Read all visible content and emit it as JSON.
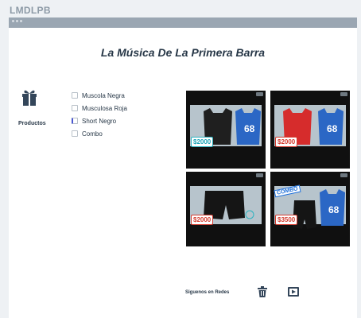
{
  "app": {
    "title": "LMDLPB"
  },
  "page": {
    "title": "La Música De La Primera Barra"
  },
  "products": {
    "label": "Productos",
    "options": [
      {
        "label": "Muscola Negra"
      },
      {
        "label": "Musculosa Roja"
      },
      {
        "label": "Short Negro"
      },
      {
        "label": "Combo"
      }
    ]
  },
  "gallery": [
    {
      "price": "$2000",
      "price_color": "#1aa4b8",
      "jersey_color": "#1f1f1f",
      "jersey2_color": "#2b67c5",
      "number": "68"
    },
    {
      "price": "$2000",
      "price_color": "#d43a2d",
      "jersey_color": "#d62c2c",
      "jersey2_color": "#2b67c5",
      "number": "68"
    },
    {
      "price": "$2000",
      "price_color": "#d43a2d",
      "jersey_color": "#151515",
      "jersey2_color": "#151515",
      "number": ""
    },
    {
      "price": "$3500",
      "price_color": "#d43a2d",
      "jersey_color": "#d62c2c",
      "jersey2_color": "#2b67c5",
      "number": "68",
      "tag": "COMBO"
    }
  ],
  "footer": {
    "social_label": "Siguenos en Redes"
  },
  "icons": {
    "products": "gift-icon",
    "social1": "trash-icon",
    "social2": "video-icon"
  }
}
